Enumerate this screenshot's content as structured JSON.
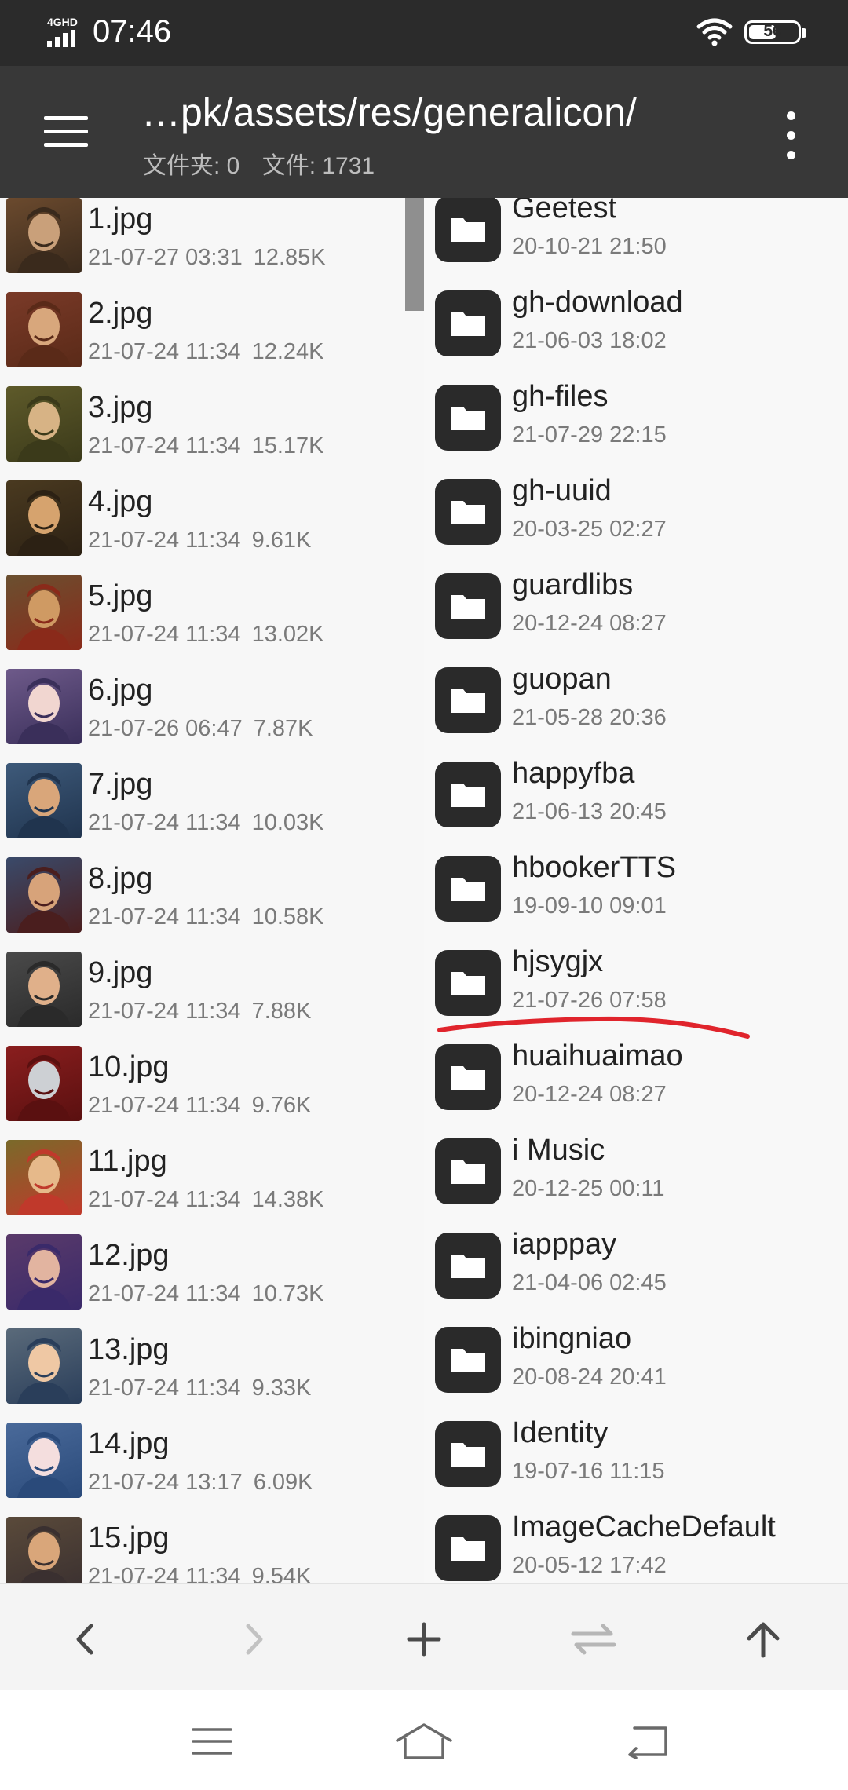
{
  "status_bar": {
    "network": "4GHD",
    "time": "07:46",
    "battery": "56",
    "battery_level": 0.56
  },
  "toolbar": {
    "path": "…pk/assets/res/generalicon/",
    "folders_label": "文件夹: 0",
    "files_label": "文件: 1731"
  },
  "left_pane": {
    "files": [
      {
        "name": "1.jpg",
        "date": "21-07-27 03:31",
        "size": "12.85K"
      },
      {
        "name": "2.jpg",
        "date": "21-07-24 11:34",
        "size": "12.24K"
      },
      {
        "name": "3.jpg",
        "date": "21-07-24 11:34",
        "size": "15.17K"
      },
      {
        "name": "4.jpg",
        "date": "21-07-24 11:34",
        "size": "9.61K"
      },
      {
        "name": "5.jpg",
        "date": "21-07-24 11:34",
        "size": "13.02K"
      },
      {
        "name": "6.jpg",
        "date": "21-07-26 06:47",
        "size": "7.87K"
      },
      {
        "name": "7.jpg",
        "date": "21-07-24 11:34",
        "size": "10.03K"
      },
      {
        "name": "8.jpg",
        "date": "21-07-24 11:34",
        "size": "10.58K"
      },
      {
        "name": "9.jpg",
        "date": "21-07-24 11:34",
        "size": "7.88K"
      },
      {
        "name": "10.jpg",
        "date": "21-07-24 11:34",
        "size": "9.76K"
      },
      {
        "name": "11.jpg",
        "date": "21-07-24 11:34",
        "size": "14.38K"
      },
      {
        "name": "12.jpg",
        "date": "21-07-24 11:34",
        "size": "10.73K"
      },
      {
        "name": "13.jpg",
        "date": "21-07-24 11:34",
        "size": "9.33K"
      },
      {
        "name": "14.jpg",
        "date": "21-07-24 13:17",
        "size": "6.09K"
      },
      {
        "name": "15.jpg",
        "date": "21-07-24 11:34",
        "size": "9.54K"
      }
    ]
  },
  "right_pane": {
    "folders": [
      {
        "name": "Geetest",
        "date": "20-10-21 21:50"
      },
      {
        "name": "gh-download",
        "date": "21-06-03 18:02"
      },
      {
        "name": "gh-files",
        "date": "21-07-29 22:15"
      },
      {
        "name": "gh-uuid",
        "date": "20-03-25 02:27"
      },
      {
        "name": "guardlibs",
        "date": "20-12-24 08:27"
      },
      {
        "name": "guopan",
        "date": "21-05-28 20:36"
      },
      {
        "name": "happyfba",
        "date": "21-06-13 20:45"
      },
      {
        "name": "hbookerTTS",
        "date": "19-09-10 09:01"
      },
      {
        "name": "hjsygjx",
        "date": "21-07-26 07:58"
      },
      {
        "name": "huaihuaimao",
        "date": "20-12-24 08:27"
      },
      {
        "name": "i Music",
        "date": "20-12-25 00:11"
      },
      {
        "name": "iapppay",
        "date": "21-04-06 02:45"
      },
      {
        "name": "ibingniao",
        "date": "20-08-24 20:41"
      },
      {
        "name": "Identity",
        "date": "19-07-16 11:15"
      },
      {
        "name": "ImageCacheDefault",
        "date": "20-05-12 17:42"
      }
    ]
  },
  "action_bar": {
    "icons": [
      "back-icon",
      "forward-icon",
      "add-icon",
      "swap-icon",
      "up-icon"
    ]
  },
  "nav_bar": {
    "icons": [
      "menu-icon",
      "home-icon",
      "return-icon"
    ]
  },
  "colors": {
    "toolbar": "#383838",
    "status_bar": "#2b2b2b",
    "annotation": "#e0242c",
    "folder_icon": "#2a2a2a"
  }
}
